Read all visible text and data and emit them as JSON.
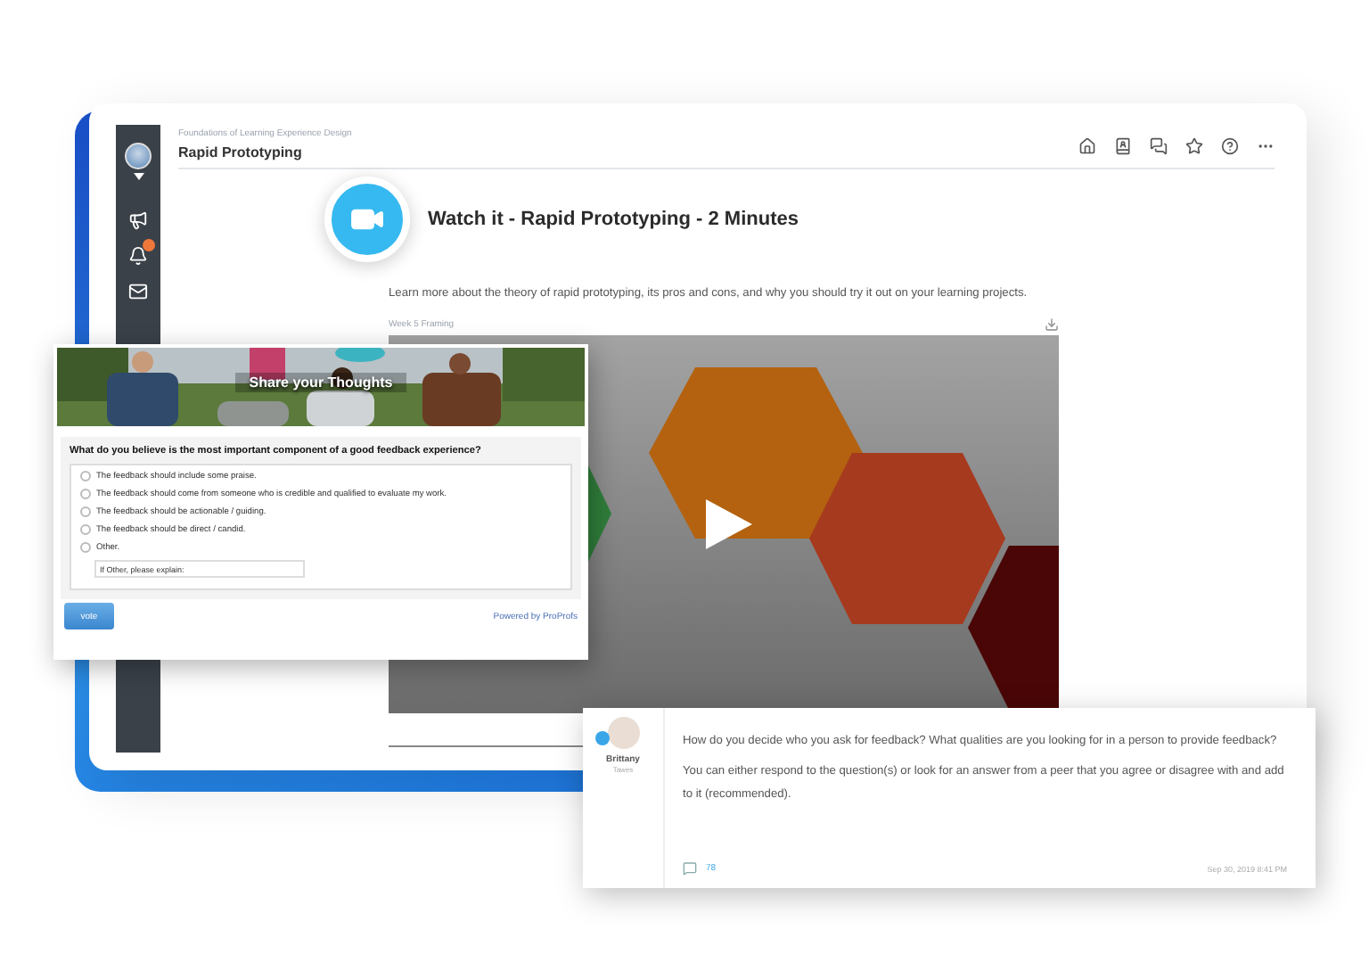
{
  "course": {
    "breadcrumb": "Foundations of Learning Experience Design",
    "title": "Rapid Prototyping"
  },
  "lesson": {
    "heading": "Watch it - Rapid Prototyping - 2 Minutes",
    "description": "Learn more about the theory of rapid prototyping, its pros and cons, and why you should try it out on your learning projects.",
    "video_label": "Week 5 Framing"
  },
  "poll": {
    "banner": "Share your Thoughts",
    "question": "What do you believe is the most important component of a good feedback experience?",
    "options": [
      {
        "label": "The feedback should include some praise.",
        "selected": false
      },
      {
        "label": "The feedback should come from someone who is credible and qualified to evaluate my work.",
        "selected": false
      },
      {
        "label": "The feedback should be actionable / guiding.",
        "selected": false
      },
      {
        "label": "The feedback should be direct / candid.",
        "selected": false
      },
      {
        "label": "Other.",
        "selected": false
      }
    ],
    "other": {
      "placeholder": "If Other, please explain:"
    },
    "button": "vote",
    "credit": "Powered by ProProfs"
  },
  "comment": {
    "author": "Brittany",
    "subtitle": "Tawes",
    "paragraphs": [
      "How do you decide who you ask for feedback? What qualities are you looking for in a person to provide feedback?",
      "You can either respond to the question(s) or look for an answer from a peer that you agree or disagree with and add to it (recommended)."
    ],
    "replies": "78",
    "timestamp": "Sep 30, 2019 8:41 PM"
  }
}
